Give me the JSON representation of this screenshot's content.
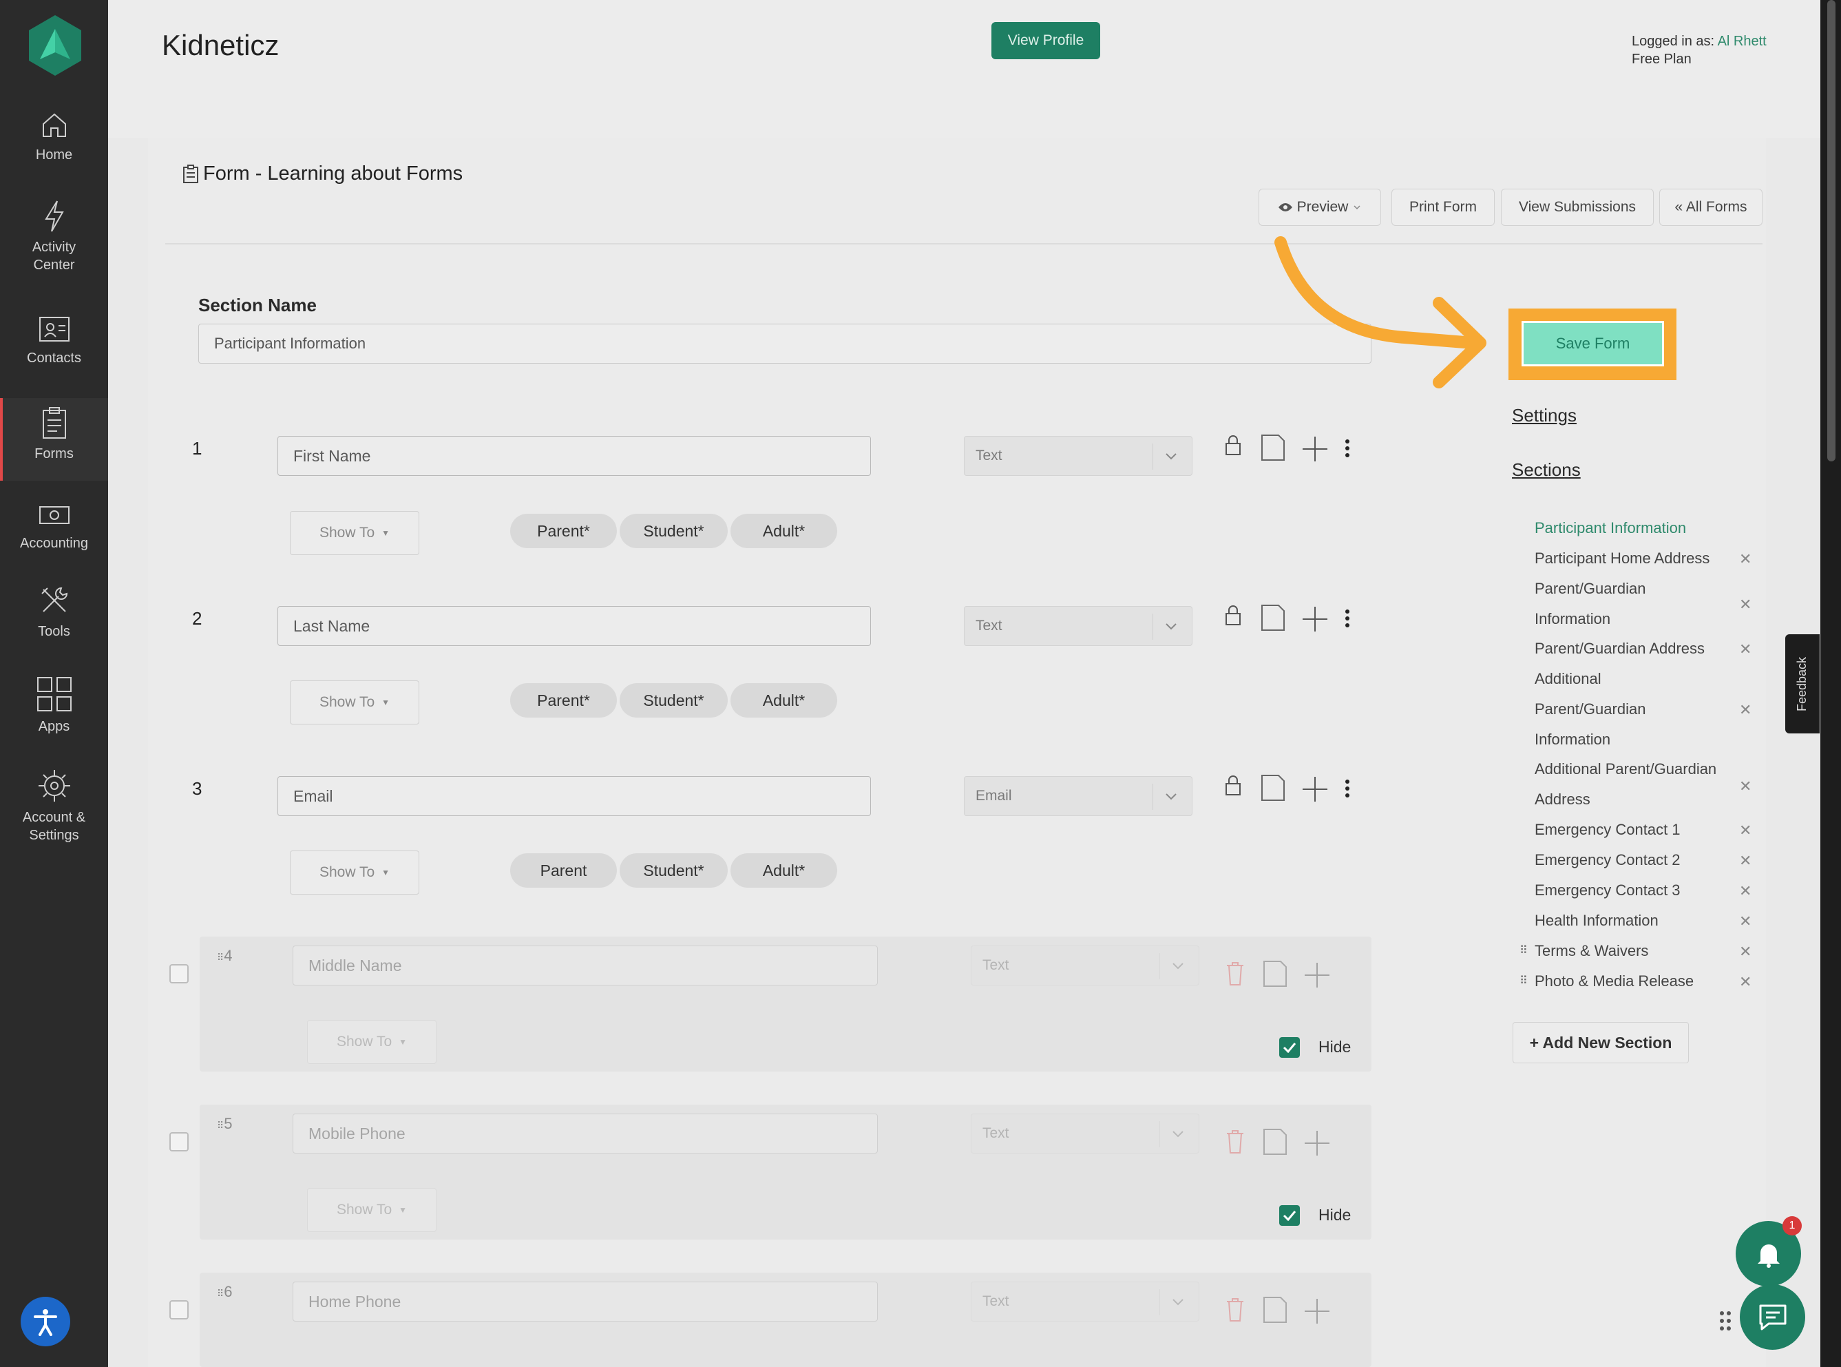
{
  "app": {
    "name": "Kidneticz"
  },
  "header": {
    "view_profile": "View Profile",
    "logged_in_prefix": "Logged in as: ",
    "user_name": "Al Rhett",
    "plan": "Free Plan"
  },
  "sidebar": {
    "items": [
      {
        "label": "Home",
        "icon": "home-icon"
      },
      {
        "label": "Activity Center",
        "icon": "lightning-icon"
      },
      {
        "label": "Contacts",
        "icon": "contacts-icon"
      },
      {
        "label": "Forms",
        "icon": "clipboard-icon",
        "active": true
      },
      {
        "label": "Accounting",
        "icon": "money-icon"
      },
      {
        "label": "Tools",
        "icon": "tools-icon"
      },
      {
        "label": "Apps",
        "icon": "apps-grid-icon"
      },
      {
        "label": "Account & Settings",
        "icon": "gear-icon"
      }
    ]
  },
  "form": {
    "title": "Form - Learning about Forms",
    "buttons": {
      "preview": "Preview",
      "print": "Print Form",
      "submissions": "View Submissions",
      "all_forms": "« All Forms"
    },
    "section_label": "Section Name",
    "section_value": "Participant Information",
    "show_to_label": "Show To",
    "hide_label": "Hide",
    "fields": [
      {
        "num": "1",
        "label": "First Name",
        "type": "Text",
        "audience": [
          "Parent*",
          "Student*",
          "Adult*"
        ]
      },
      {
        "num": "2",
        "label": "Last Name",
        "type": "Text",
        "audience": [
          "Parent*",
          "Student*",
          "Adult*"
        ]
      },
      {
        "num": "3",
        "label": "Email",
        "type": "Email",
        "audience": [
          "Parent",
          "Student*",
          "Adult*"
        ]
      },
      {
        "num": "4",
        "label": "Middle Name",
        "type": "Text",
        "hidden": true
      },
      {
        "num": "5",
        "label": "Mobile Phone",
        "type": "Text",
        "hidden": true
      },
      {
        "num": "6",
        "label": "Home Phone",
        "type": "Text",
        "hidden": true
      }
    ]
  },
  "right": {
    "save": "Save Form",
    "settings": "Settings",
    "sections_title": "Sections",
    "sections": [
      "Participant Information",
      "Participant Home Address",
      "Parent/Guardian Information",
      "Parent/Guardian Address",
      "Additional Parent/Guardian Information",
      "Additional Parent/Guardian Address",
      "Emergency Contact 1",
      "Emergency Contact 2",
      "Emergency Contact 3",
      "Health Information",
      "Terms & Waivers",
      "Photo & Media Release"
    ],
    "add_section": "+ Add New Section"
  },
  "feedback": "Feedback",
  "notifications_count": "1",
  "colors": {
    "accent": "#1e7f63",
    "highlight": "#f7a934",
    "active_nav": "#e04848"
  }
}
